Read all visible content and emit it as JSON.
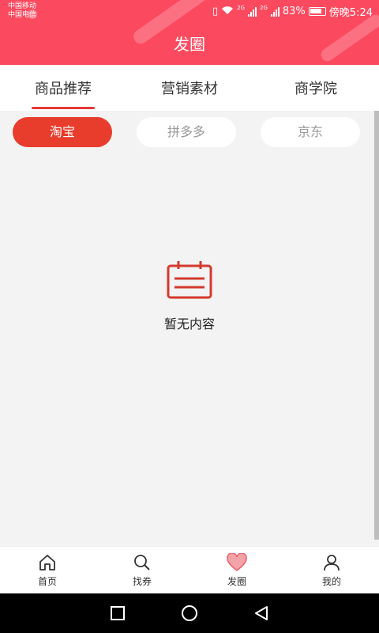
{
  "status": {
    "carrier1": "中国移动",
    "carrier2": "中国电信",
    "net1": "2G",
    "net2": "2G",
    "battery": "83%",
    "time": "傍晚5:24"
  },
  "header": {
    "title": "发圈"
  },
  "tabs": [
    {
      "label": "商品推荐",
      "active": true
    },
    {
      "label": "营销素材"
    },
    {
      "label": "商学院"
    }
  ],
  "subtabs": [
    {
      "label": "淘宝",
      "active": true
    },
    {
      "label": "拼多多"
    },
    {
      "label": "京东"
    }
  ],
  "empty": {
    "text": "暂无内容",
    "icon": "calendar-icon"
  },
  "bottom_nav": [
    {
      "label": "首页",
      "icon": "home-icon"
    },
    {
      "label": "找券",
      "icon": "search-icon"
    },
    {
      "label": "发圈",
      "icon": "heart-icon",
      "active": true
    },
    {
      "label": "我的",
      "icon": "user-icon"
    }
  ],
  "colors": {
    "header": "#fb4a5f",
    "accent": "#e83c2c"
  }
}
